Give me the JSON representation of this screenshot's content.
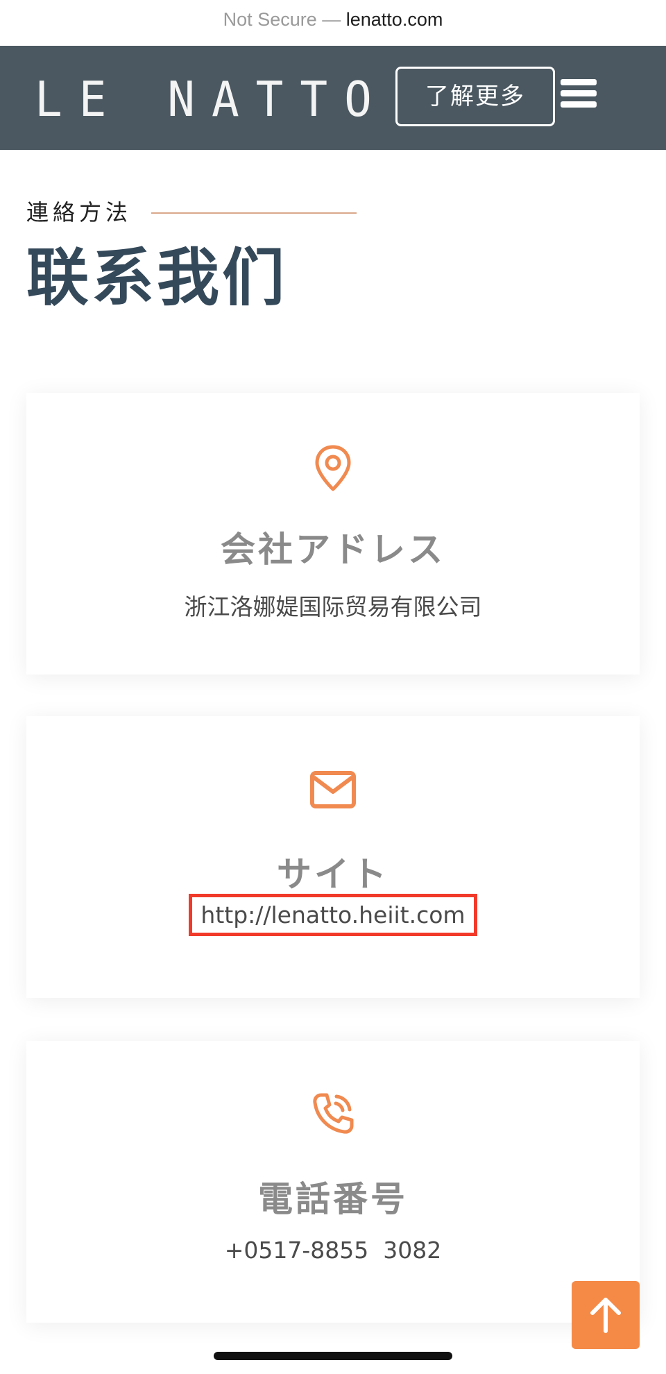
{
  "browser": {
    "prefix": "Not Secure — ",
    "domain": "lenatto.com"
  },
  "header": {
    "logo_text": "LE NATTO",
    "learn_more_label": "了解更多",
    "menu_icon": "hamburger-menu-icon"
  },
  "section": {
    "eyebrow": "連絡方法",
    "title": "联系我们"
  },
  "cards": [
    {
      "icon": "location-pin-icon",
      "title": "会社アドレス",
      "text": "浙江洛娜媞国际贸易有限公司"
    },
    {
      "icon": "envelope-icon",
      "title": "サイト",
      "text": "http://lenatto.heiit.com"
    },
    {
      "icon": "phone-icon",
      "title": "電話番号",
      "text": "+0517-8855  3082"
    }
  ],
  "colors": {
    "navbar": "#4b5861",
    "accent": "#f58a47",
    "highlight_box": "#f23a2a",
    "title_dark": "#34495a"
  },
  "scroll_top_icon": "arrow-up-icon"
}
